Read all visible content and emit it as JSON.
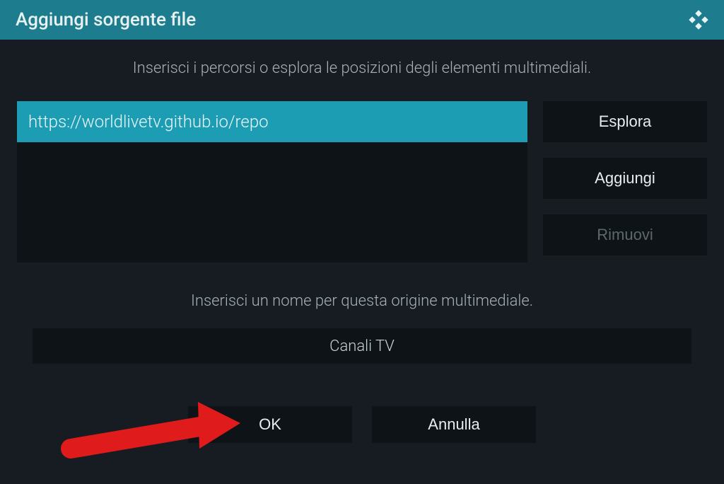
{
  "titlebar": {
    "title": "Aggiungi sorgente file"
  },
  "instructions": {
    "paths": "Inserisci i percorsi o esplora le posizioni degli elementi multimediali.",
    "name": "Inserisci un nome per questa origine multimediale."
  },
  "path_input": {
    "value": "https://worldlivetv.github.io/repo"
  },
  "side_buttons": {
    "browse": "Esplora",
    "add": "Aggiungi",
    "remove": "Rimuovi"
  },
  "name_input": {
    "value": "Canali TV"
  },
  "footer": {
    "ok": "OK",
    "cancel": "Annulla"
  },
  "colors": {
    "accent": "#1d9db4",
    "titlebar": "#1d7d8e",
    "panel": "#0d1316",
    "bg": "#161c21"
  }
}
